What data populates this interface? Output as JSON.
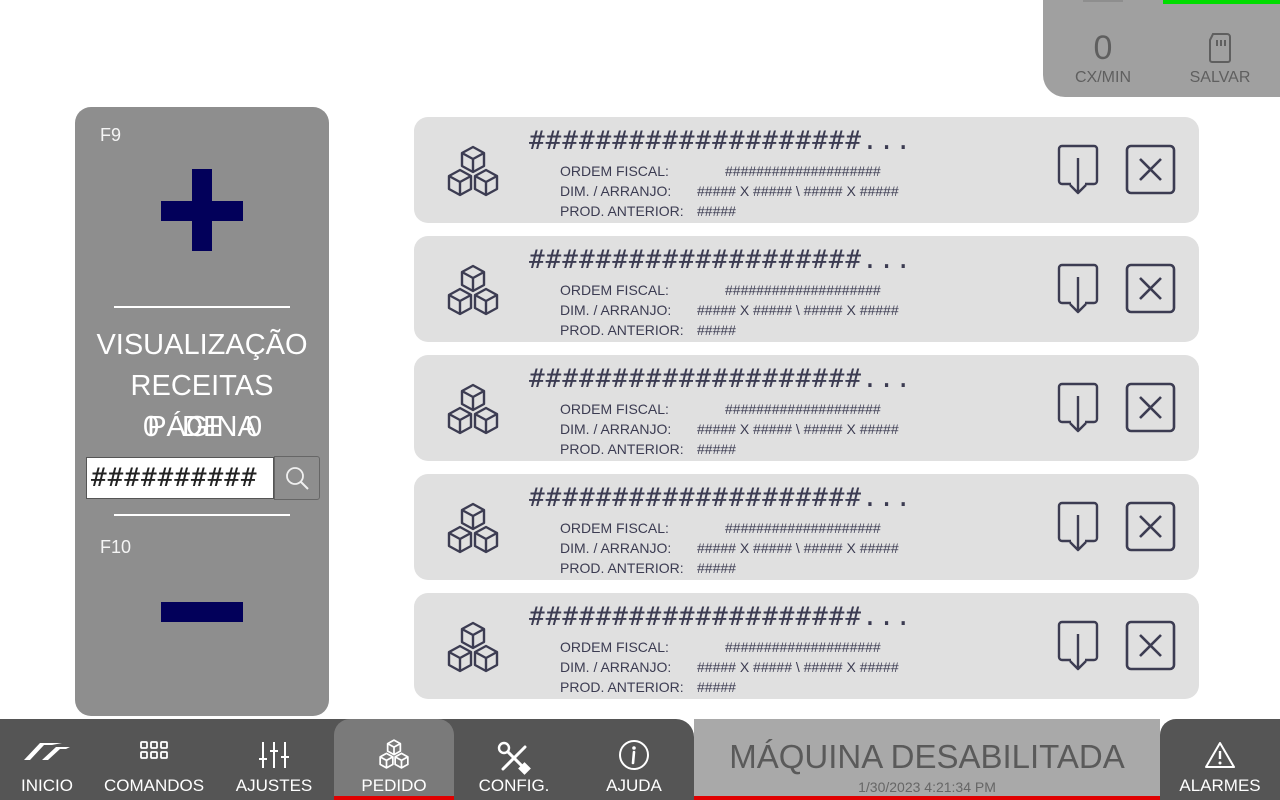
{
  "status": {
    "rate_value": "0",
    "rate_label": "CX/MIN",
    "save_label": "SALVAR"
  },
  "left_panel": {
    "f9_label": "F9",
    "f10_label": "F10",
    "title_line1": "VISUALIZAÇÃO",
    "title_line2": "RECEITAS PÁGINA",
    "page_current": "0",
    "page_of": "DE",
    "page_total": "0",
    "search_value": "##########"
  },
  "recipes": [
    {
      "title": "####################...",
      "fiscal_label": "ORDEM FISCAL:",
      "fiscal_value": "####################",
      "dim_label": "DIM. / ARRANJO:",
      "dim_value": "##### X ##### \\ ##### X #####",
      "prev_label": "PROD. ANTERIOR:",
      "prev_value": "#####"
    },
    {
      "title": "####################...",
      "fiscal_label": "ORDEM FISCAL:",
      "fiscal_value": "####################",
      "dim_label": "DIM. / ARRANJO:",
      "dim_value": "##### X ##### \\ ##### X #####",
      "prev_label": "PROD. ANTERIOR:",
      "prev_value": "#####"
    },
    {
      "title": "####################...",
      "fiscal_label": "ORDEM FISCAL:",
      "fiscal_value": "####################",
      "dim_label": "DIM. / ARRANJO:",
      "dim_value": "##### X ##### \\ ##### X #####",
      "prev_label": "PROD. ANTERIOR:",
      "prev_value": "#####"
    },
    {
      "title": "####################...",
      "fiscal_label": "ORDEM FISCAL:",
      "fiscal_value": "####################",
      "dim_label": "DIM. / ARRANJO:",
      "dim_value": "##### X ##### \\ ##### X #####",
      "prev_label": "PROD. ANTERIOR:",
      "prev_value": "#####"
    },
    {
      "title": "####################...",
      "fiscal_label": "ORDEM FISCAL:",
      "fiscal_value": "####################",
      "dim_label": "DIM. / ARRANJO:",
      "dim_value": "##### X ##### \\ ##### X #####",
      "prev_label": "PROD. ANTERIOR:",
      "prev_value": "#####"
    }
  ],
  "nav": {
    "items": [
      {
        "label": "INICIO",
        "icon": "logo-icon"
      },
      {
        "label": "COMANDOS",
        "icon": "grid-icon"
      },
      {
        "label": "AJUSTES",
        "icon": "sliders-icon"
      },
      {
        "label": "PEDIDO",
        "icon": "cubes-icon",
        "active": true
      },
      {
        "label": "CONFIG.",
        "icon": "tools-icon"
      },
      {
        "label": "AJUDA",
        "icon": "info-icon"
      }
    ],
    "machine_status": "MÁQUINA DESABILITADA",
    "datetime": "1/30/2023 4:21:34 PM",
    "alarms_label": "ALARMES"
  },
  "colors": {
    "accent_navy": "#02005a",
    "panel_gray": "#8e8e8e",
    "card_gray": "#e0e0e0",
    "nav_dark": "#555555",
    "active_red": "#e00000",
    "status_green": "#00dd00"
  }
}
